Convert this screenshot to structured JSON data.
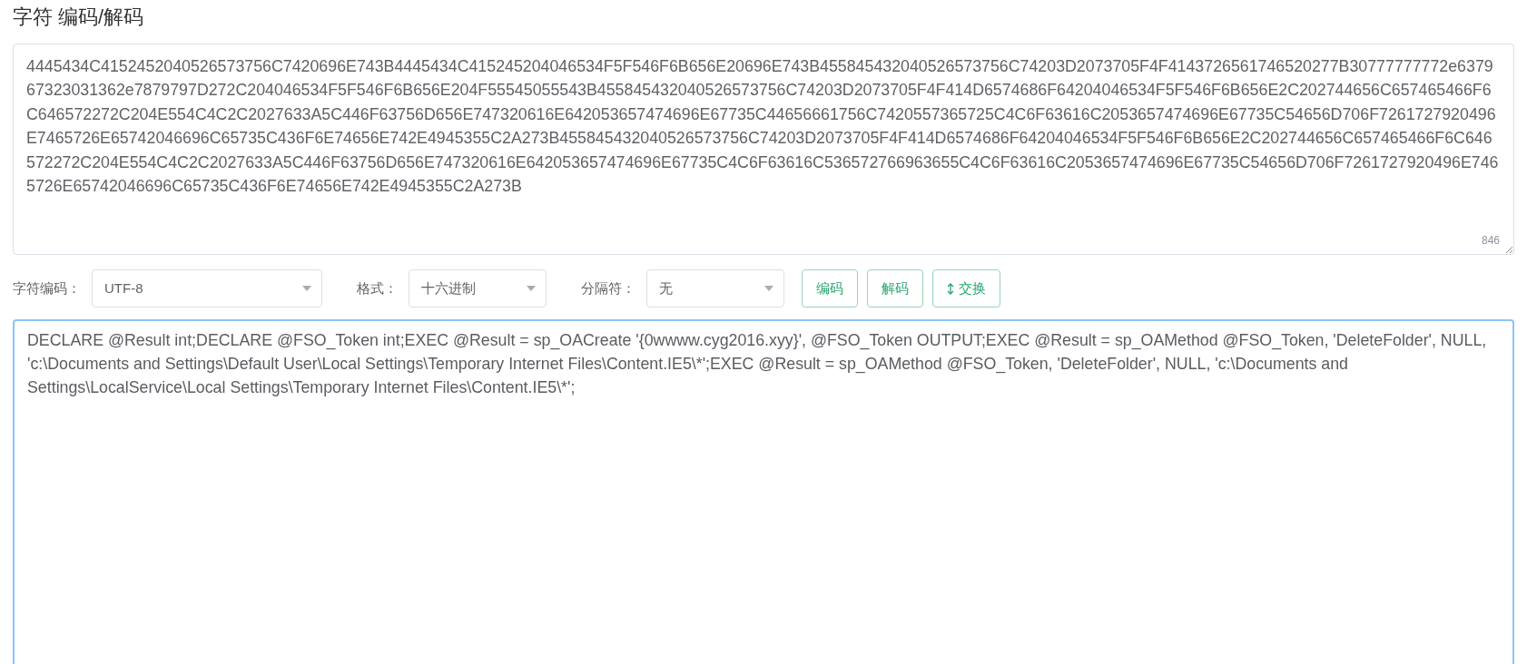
{
  "title": "字符 编码/解码",
  "input": {
    "value": "4445434C4152452040526573756C7420696E743B4445434C415245204046534F5F546F6B656E20696E743B455845432040526573756C74203D2073705F4F4143726561746520277B30777777772e637967323031362e7879797D272C204046534F5F546F6B656E204F55545055543B455845432040526573756C74203D2073705F4F414D6574686F64204046534F5F546F6B656E2C202744656C657465466F6C646572272C204E554C4C2C2027633A5C446F63756D656E747320616E642053657474696E67735C44656661756C7420557365725C4C6F63616C2053657474696E67735C54656D706F7261727920496E7465726E65742046696C65735C436F6E74656E742E4945355C2A273B455845432040526573756C74203D2073705F4F414D6574686F64204046534F5F546F6B656E2C202744656C657465466F6C646572272C204E554C4C2C2027633A5C446F63756D656E747320616E642053657474696E67735C4C6F63616C536572766963655C4C6F63616C2053657474696E67735C54656D706F7261727920496E7465726E65742046696C65735C436F6E74656E742E4945355C2A273B",
    "count": "846"
  },
  "options": [
    {
      "label": "字符编码：",
      "value": "UTF-8"
    },
    {
      "label": "格式：",
      "value": "十六进制"
    },
    {
      "label": "分隔符：",
      "value": "无"
    }
  ],
  "buttons": [
    {
      "kind": "encode",
      "label": "编码"
    },
    {
      "kind": "decode",
      "label": "解码"
    },
    {
      "kind": "swap",
      "label": "交换"
    }
  ],
  "output": {
    "value": "DECLARE @Result int;DECLARE @FSO_Token int;EXEC @Result = sp_OACreate '{0wwww.cyg2016.xyy}', @FSO_Token OUTPUT;EXEC @Result = sp_OAMethod @FSO_Token, 'DeleteFolder', NULL, 'c:\\Documents and Settings\\Default User\\Local Settings\\Temporary Internet Files\\Content.IE5\\*';EXEC @Result = sp_OAMethod @FSO_Token, 'DeleteFolder', NULL, 'c:\\Documents and Settings\\LocalService\\Local Settings\\Temporary Internet Files\\Content.IE5\\*';",
    "focused": true
  }
}
